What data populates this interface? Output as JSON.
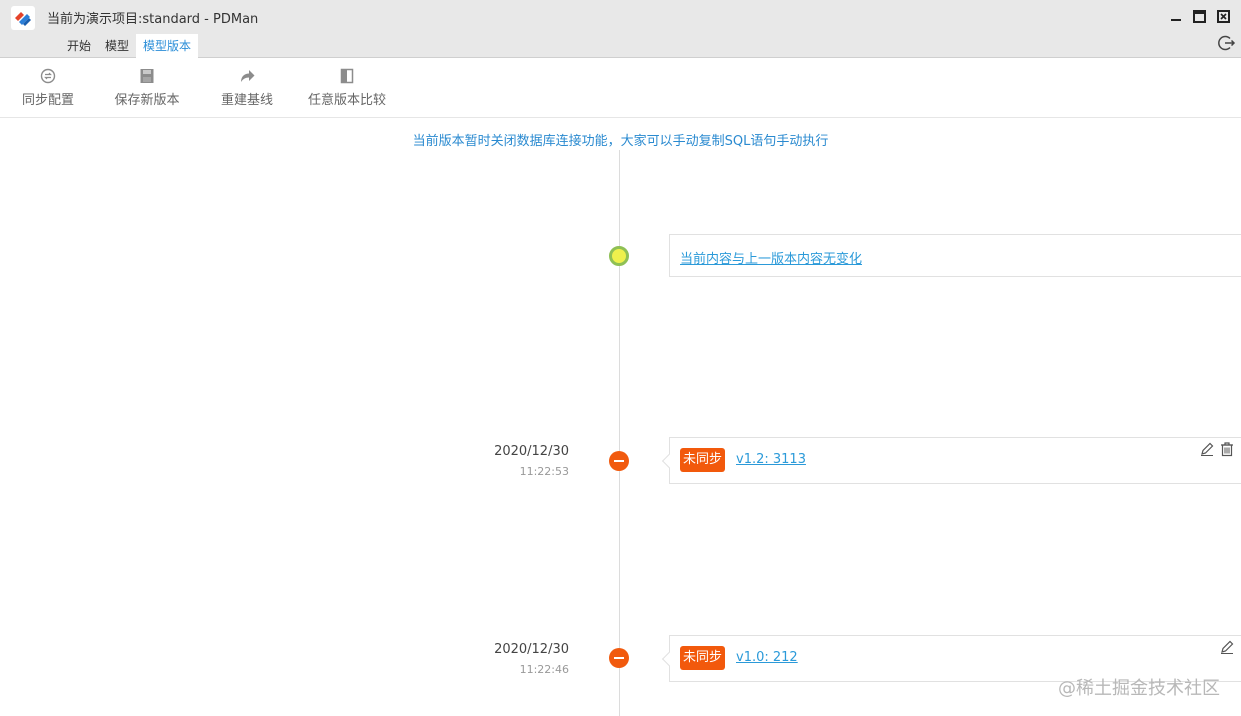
{
  "window": {
    "title": "当前为演示项目:standard - PDMan"
  },
  "tabs": [
    {
      "label": "开始",
      "active": false
    },
    {
      "label": "模型",
      "active": false
    },
    {
      "label": "模型版本",
      "active": true
    }
  ],
  "toolbar": {
    "items": [
      {
        "label": "同步配置",
        "icon": "sync-icon"
      },
      {
        "label": "保存新版本",
        "icon": "save-icon"
      },
      {
        "label": "重建基线",
        "icon": "share-arrow-icon"
      },
      {
        "label": "任意版本比较",
        "icon": "compare-icon"
      }
    ]
  },
  "notice": "当前版本暂时关闭数据库连接功能，大家可以手动复制SQL语句手动执行",
  "current_change": {
    "link_text": "当前内容与上一版本内容无变化"
  },
  "versions": [
    {
      "date": "2020/12/30",
      "time": "11:22:53",
      "status": "未同步",
      "link_text": "v1.2: 3113"
    },
    {
      "date": "2020/12/30",
      "time": "11:22:46",
      "status": "未同步",
      "link_text": "v1.0: 212"
    }
  ],
  "watermark": "@稀土掘金技术社区",
  "colors": {
    "accent": "#2b8ed8",
    "link": "#2b9ad9",
    "badge": "#f2590c",
    "current_dot_fill": "#eef04d",
    "current_dot_border": "#8fc055"
  }
}
